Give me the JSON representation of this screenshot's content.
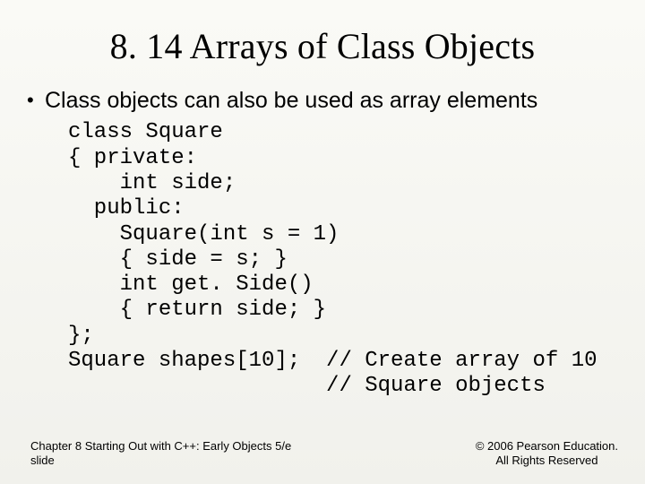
{
  "title": "8. 14 Arrays of Class Objects",
  "bullet": "Class objects can also be used as array elements",
  "code": "class Square\n{ private:\n    int side;\n  public:\n    Square(int s = 1)\n    { side = s; }\n    int get. Side()\n    { return side; }\n};\nSquare shapes[10];  // Create array of 10\n                    // Square objects",
  "footer_left_line1": "Chapter 8 Starting Out with C++: Early Objects 5/e",
  "footer_left_line2": "slide",
  "footer_right_line1": "© 2006 Pearson Education.",
  "footer_right_line2": "All Rights Reserved"
}
